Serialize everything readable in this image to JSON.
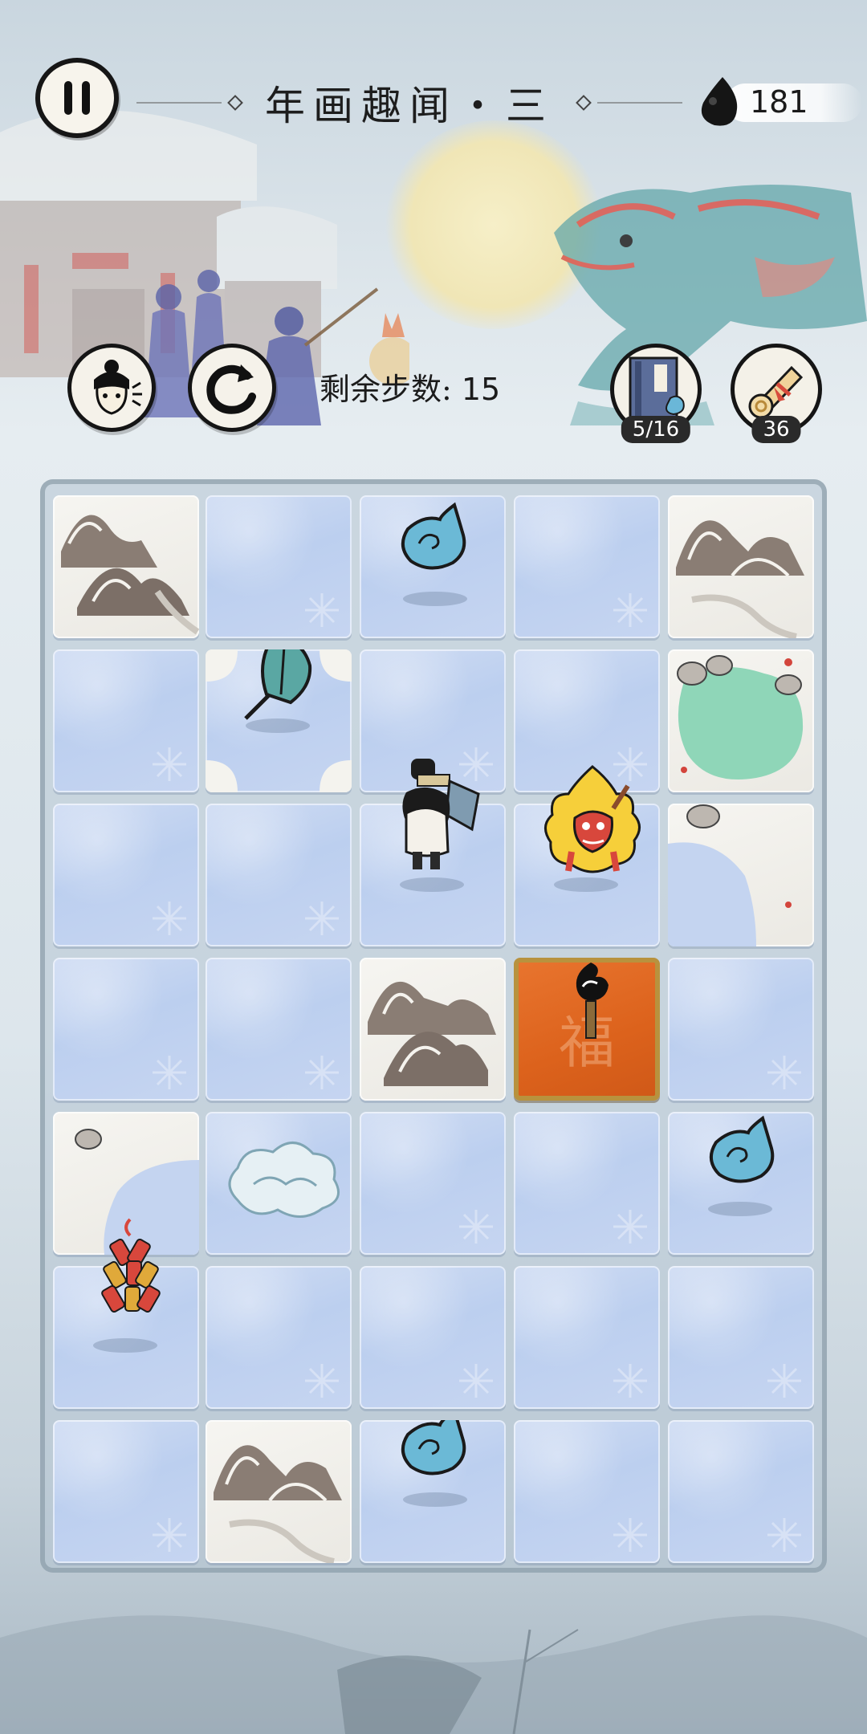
{
  "header": {
    "title": "年画趣闻・三",
    "ink_count": "181"
  },
  "toolbar": {
    "steps_label": "剩余步数:",
    "steps_value": "15"
  },
  "items": {
    "book_count": "5/16",
    "scroll_count": "36"
  },
  "board": {
    "cols": 5,
    "rows": 7,
    "fu_char": "福",
    "colors": {
      "ice": "#c4d4f0",
      "snow": "#f2f1ec",
      "fu": "#e06a24",
      "fu_border": "#b8923e"
    }
  }
}
